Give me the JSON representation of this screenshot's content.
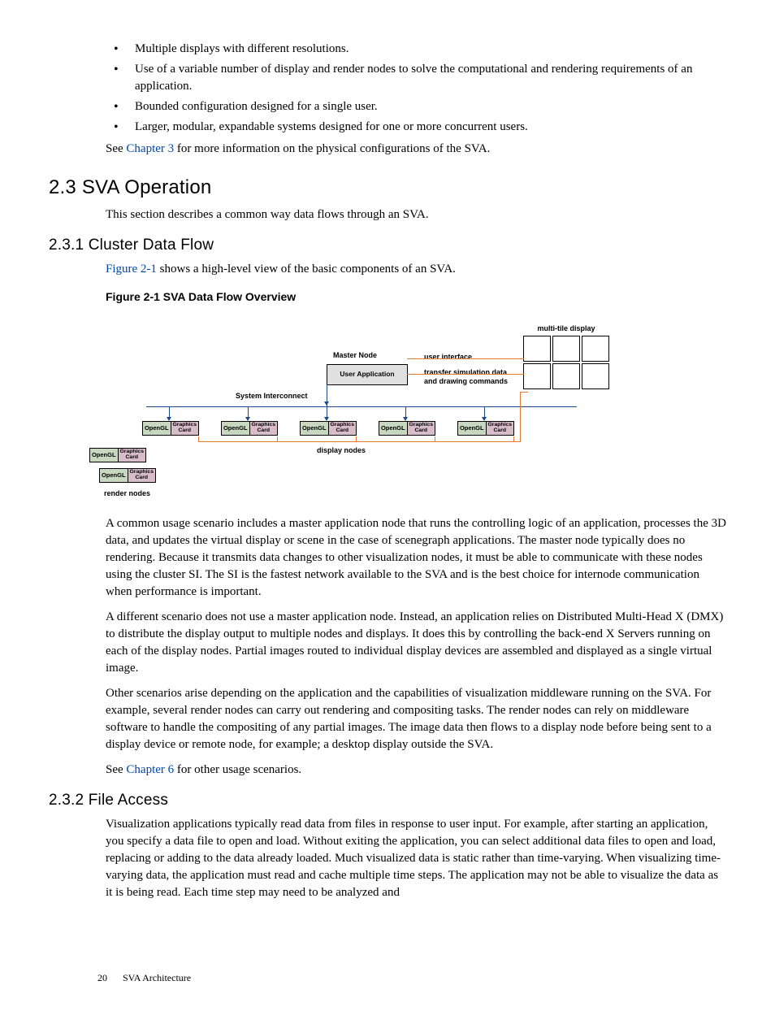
{
  "bullets": [
    "Multiple displays with different resolutions.",
    "Use of a variable number of display and render nodes to solve the computational and rendering requirements of an application.",
    "Bounded configuration designed for a single user.",
    "Larger, modular, expandable systems designed for one or more concurrent users."
  ],
  "see_ch3_pre": "See ",
  "see_ch3_link": "Chapter 3",
  "see_ch3_post": " for more information on the physical configurations of the SVA.",
  "sec23_heading": "2.3  SVA Operation",
  "sec23_intro": "This section describes a common way data flows through an SVA.",
  "sec231_heading": "2.3.1  Cluster Data Flow",
  "sec231_intro_link": "Figure 2-1",
  "sec231_intro_post": " shows a high-level view of the basic components of an SVA.",
  "figure_title": "Figure  2-1  SVA Data Flow Overview",
  "diagram": {
    "multi_tile": "multi-tile display",
    "master_node": "Master Node",
    "user_app": "User Application",
    "sys_interconnect": "System Interconnect",
    "user_interface": "user interface",
    "transfer": "transfer simulation data\nand drawing commands",
    "opengl": "OpenGL",
    "graphics": "Graphics\nCard",
    "display_nodes": "display nodes",
    "render_nodes": "render nodes"
  },
  "para1": "A common usage scenario includes a master application node that runs the controlling logic of an application, processes the 3D data, and updates the virtual display or scene in the case of scenegraph applications. The master node typically does no rendering. Because it transmits data changes to other visualization nodes, it must be able to communicate with these nodes using the cluster SI. The SI is the fastest network available to the SVA and is the best choice for internode communication when performance is important.",
  "para2": "A different scenario does not use a master application node. Instead, an application relies on Distributed Multi-Head X (DMX) to distribute the display output to multiple nodes and displays. It does this by controlling the back-end X Servers running on each of the display nodes. Partial images routed to individual display devices are assembled and displayed as a single virtual image.",
  "para3": "Other scenarios arise depending on the application and the capabilities of visualization middleware running on the SVA. For example, several render nodes can carry out rendering and compositing tasks. The render nodes can rely on middleware software to handle the compositing of any partial images. The image data then flows to a display node before being sent to a display device or remote node, for example; a desktop display outside the SVA.",
  "see_ch6_pre": "See ",
  "see_ch6_link": "Chapter 6",
  "see_ch6_post": " for other usage scenarios.",
  "sec232_heading": "2.3.2  File Access",
  "sec232_para": "Visualization applications typically read data from files in response to user input. For example, after starting an application, you specify a data file to open and load. Without exiting the application, you can select additional data files to open and load, replacing or adding to the data already loaded. Much visualized data is static rather than time-varying. When visualizing time-varying data, the application must read and cache multiple time steps. The application may not be able to visualize the data as it is being read. Each time step may need to be analyzed and",
  "footer": {
    "page": "20",
    "chapter": "SVA Architecture"
  }
}
